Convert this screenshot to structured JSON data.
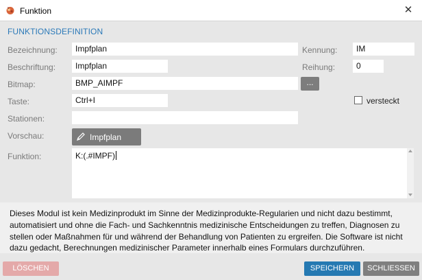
{
  "window": {
    "title": "Funktion",
    "close_glyph": "✕",
    "app_icon": "app-logo-icon"
  },
  "section_title": "FUNKTIONSDEFINITION",
  "form": {
    "bezeichnung": {
      "label": "Bezeichnung:",
      "value": "Impfplan"
    },
    "kennung": {
      "label": "Kennung:",
      "value": "IM"
    },
    "beschriftung": {
      "label": "Beschriftung:",
      "value": "Impfplan"
    },
    "reihung": {
      "label": "Reihung:",
      "value": "0"
    },
    "bitmap": {
      "label": "Bitmap:",
      "value": "BMP_AIMPF",
      "browse_label": "..."
    },
    "taste": {
      "label": "Taste:",
      "value": "Ctrl+I"
    },
    "versteckt": {
      "label": "versteckt",
      "checked": false
    },
    "stationen": {
      "label": "Stationen:",
      "value": ""
    },
    "vorschau": {
      "label": "Vorschau:",
      "button_label": "Impfplan",
      "icon": "pen-icon"
    },
    "funktion": {
      "label": "Funktion:",
      "value": "K:(.#IMPF)"
    }
  },
  "disclaimer": "Dieses Modul ist kein Medizinprodukt im Sinne der Medizinprodukte-Regularien und nicht dazu bestimmt, automatisiert und ohne die Fach- und Sachkenntnis medizinische Entscheidungen zu treffen, Diagnosen zu stellen oder Maßnahmen für und während der Behandlung von Patienten zu ergreifen. Die Software ist nicht dazu gedacht, Berechnungen medizinischer Parameter innerhalb eines Formulars durchzuführen.",
  "footer": {
    "delete_label": "LÖSCHEN",
    "save_label": "SPEICHERN",
    "close_label": "SCHLIESSEN"
  },
  "colors": {
    "accent": "#2b79b8",
    "save": "#2579b2",
    "delete": "#e4a9a9",
    "neutral_button": "#7f7f7f"
  }
}
